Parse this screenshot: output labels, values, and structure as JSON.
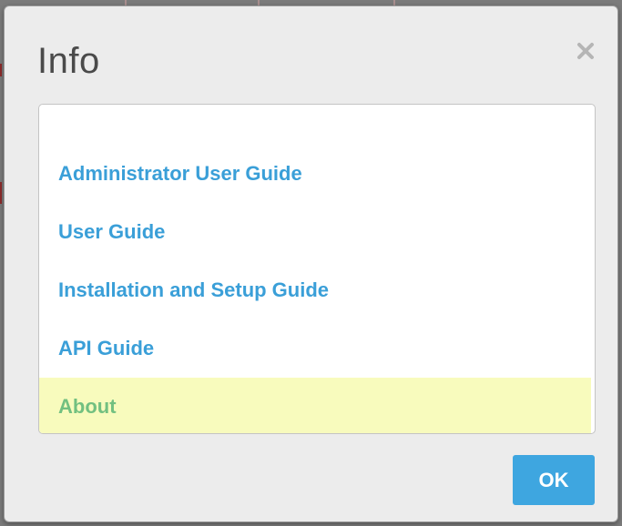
{
  "dialog": {
    "title": "Info",
    "close_icon": "close-icon",
    "ok_label": "OK"
  },
  "links": [
    {
      "label": "Administrator User Guide"
    },
    {
      "label": "User Guide"
    },
    {
      "label": "Installation and Setup Guide"
    },
    {
      "label": "API Guide"
    },
    {
      "label": "About",
      "highlighted": true
    }
  ],
  "colors": {
    "link": "#3a9fd8",
    "highlight_bg": "#f8fbbd",
    "highlight_text": "#72c080",
    "ok_button": "#3ea6e0"
  }
}
